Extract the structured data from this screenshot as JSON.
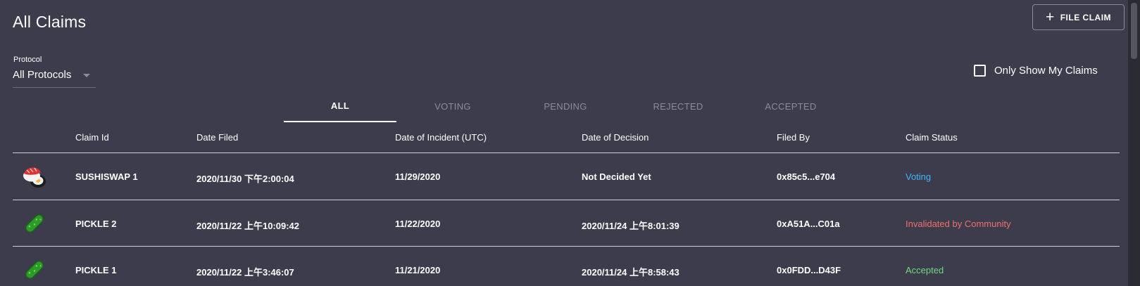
{
  "header": {
    "title": "All Claims",
    "file_claim_label": "FILE CLAIM"
  },
  "filters": {
    "protocol_label": "Protocol",
    "protocol_value": "All Protocols",
    "only_mine_label": "Only Show My Claims",
    "only_mine_checked": false
  },
  "tabs": [
    {
      "label": "ALL",
      "active": true
    },
    {
      "label": "VOTING",
      "active": false
    },
    {
      "label": "PENDING",
      "active": false
    },
    {
      "label": "REJECTED",
      "active": false
    },
    {
      "label": "ACCEPTED",
      "active": false
    }
  ],
  "table": {
    "columns": [
      "Claim Id",
      "Date Filed",
      "Date of Incident (UTC)",
      "Date of Decision",
      "Filed By",
      "Claim Status"
    ],
    "rows": [
      {
        "icon": "sushi-icon",
        "claim_id": "SUSHISWAP 1",
        "date_filed": "2020/11/30 下午2:00:04",
        "incident": "11/29/2020",
        "decision": "Not Decided Yet",
        "filed_by": "0x85c5...e704",
        "status": "Voting",
        "status_color": "#3eb8ff"
      },
      {
        "icon": "pickle-icon",
        "claim_id": "PICKLE 2",
        "date_filed": "2020/11/22 上午10:09:42",
        "incident": "11/22/2020",
        "decision": "2020/11/24 上午8:01:39",
        "filed_by": "0xA51A...C01a",
        "status": "Invalidated by Community",
        "status_color": "#f0706a"
      },
      {
        "icon": "pickle-icon",
        "claim_id": "PICKLE 1",
        "date_filed": "2020/11/22 上午3:46:07",
        "incident": "11/21/2020",
        "decision": "2020/11/24 上午8:58:43",
        "filed_by": "0x0FDD...D43F",
        "status": "Accepted",
        "status_color": "#6fdc7c"
      }
    ]
  }
}
